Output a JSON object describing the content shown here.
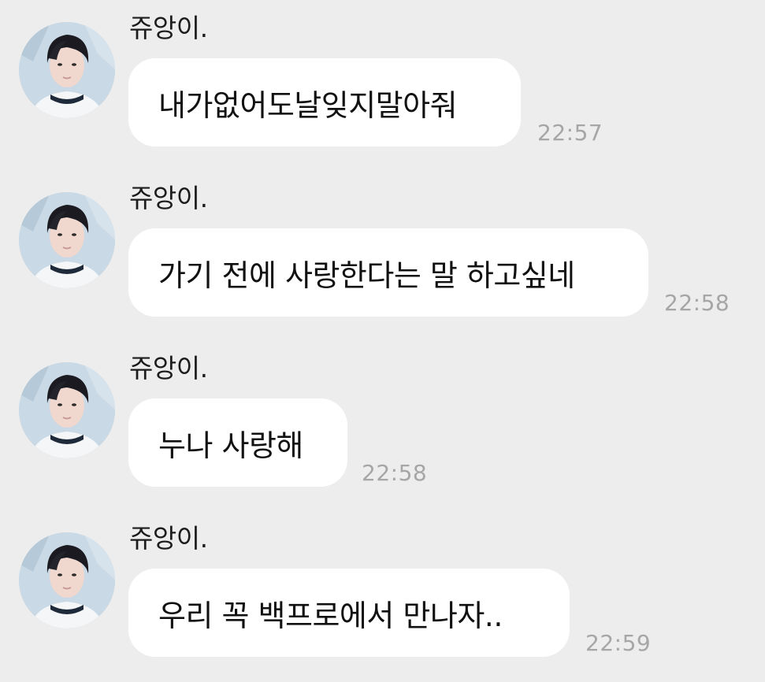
{
  "messages": [
    {
      "sender": "쥬앙이.",
      "text": "내가없어도날잊지말아줘",
      "time": "22:57"
    },
    {
      "sender": "쥬앙이.",
      "text": "가기 전에 사랑한다는 말 하고싶네",
      "time": "22:58"
    },
    {
      "sender": "쥬앙이.",
      "text": "누나 사랑해",
      "time": "22:58"
    },
    {
      "sender": "쥬앙이.",
      "text": "우리 꼭 백프로에서 만나자..",
      "time": "22:59"
    }
  ]
}
